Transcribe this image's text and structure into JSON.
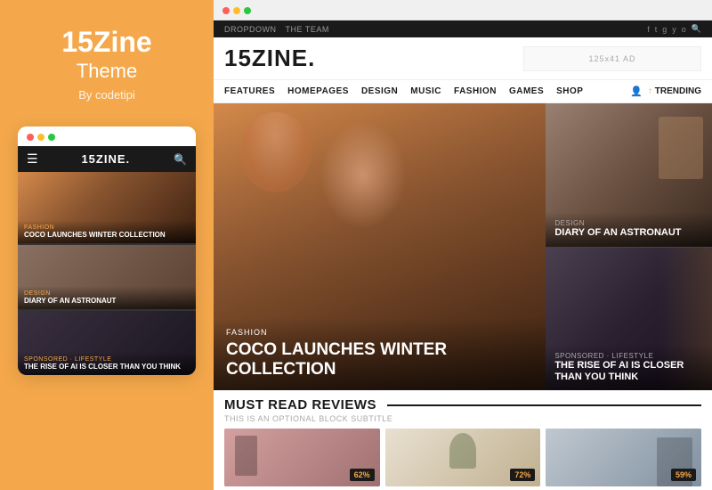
{
  "left": {
    "title": "15Zine",
    "subtitle": "Theme",
    "by": "By codetipi"
  },
  "mobile": {
    "logo": "15ZINE.",
    "cards": [
      {
        "tag": "FASHION",
        "title": "COCO LAUNCHES WINTER COLLECTION"
      },
      {
        "tag": "DESIGN",
        "title": "DIARY OF AN ASTRONAUT"
      },
      {
        "tag": "SPONSORED · LIFESTYLE",
        "title": "THE RISE OF AI IS CLOSER THAN YOU THINK"
      }
    ]
  },
  "browser": {
    "topbar": {
      "items": [
        "DROPDOWN",
        "THE TEAM"
      ],
      "socials": [
        "f",
        "t",
        "g",
        "y",
        "o"
      ]
    },
    "logo": "15ZINE.",
    "ad_text": "125x41 AD",
    "nav": {
      "items": [
        "FEATURES",
        "HOMEPAGES",
        "DESIGN",
        "MUSIC",
        "FASHION",
        "GAMES",
        "SHOP"
      ],
      "trending": "TRENDING"
    },
    "hero": {
      "tag": "FASHION",
      "title": "COCO LAUNCHES WINTER COLLECTION"
    },
    "side_cards": [
      {
        "tag": "DESIGN",
        "title": "DIARY OF AN ASTRONAUT"
      },
      {
        "tag": "SPONSORED · LIFESTYLE",
        "title": "THE RISE OF AI IS CLOSER THAN YOU THINK"
      }
    ],
    "reviews": {
      "title": "MUST READ REVIEWS",
      "subtitle": "THIS IS AN OPTIONAL BLOCK SUBTITLE",
      "cards": [
        {
          "pct": "62%",
          "bg": 1
        },
        {
          "pct": "72%",
          "bg": 2
        },
        {
          "pct": "59%",
          "bg": 3
        }
      ]
    }
  }
}
